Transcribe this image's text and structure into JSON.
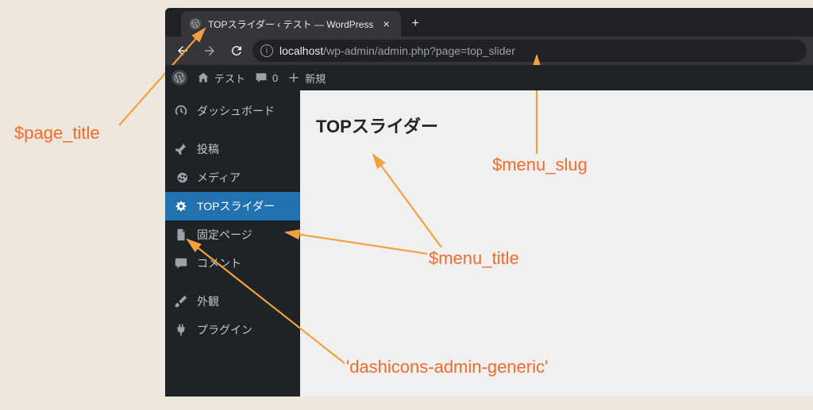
{
  "browser": {
    "tab_title": "TOPスライダー ‹ テスト — WordPress",
    "url_host": "localhost",
    "url_path": "/wp-admin/admin.php?page=top_slider"
  },
  "adminbar": {
    "site_name": "テスト",
    "comments": "0",
    "new_label": "新規"
  },
  "sidebar": {
    "items": [
      {
        "icon": "dashboard",
        "label": "ダッシュボード",
        "current": false
      },
      {
        "icon": "pin",
        "label": "投稿",
        "current": false
      },
      {
        "icon": "media",
        "label": "メディア",
        "current": false
      },
      {
        "icon": "gear",
        "label": "TOPスライダー",
        "current": true
      },
      {
        "icon": "page",
        "label": "固定ページ",
        "current": false
      },
      {
        "icon": "comment",
        "label": "コメント",
        "current": false
      },
      {
        "icon": "brush",
        "label": "外観",
        "current": false
      },
      {
        "icon": "plugin",
        "label": "プラグイン",
        "current": false
      }
    ]
  },
  "content": {
    "heading": "TOPスライダー"
  },
  "annotations": {
    "page_title": "$page_title",
    "menu_slug": "$menu_slug",
    "menu_title": "$menu_title",
    "dashicon": "'dashicons-admin-generic'"
  }
}
